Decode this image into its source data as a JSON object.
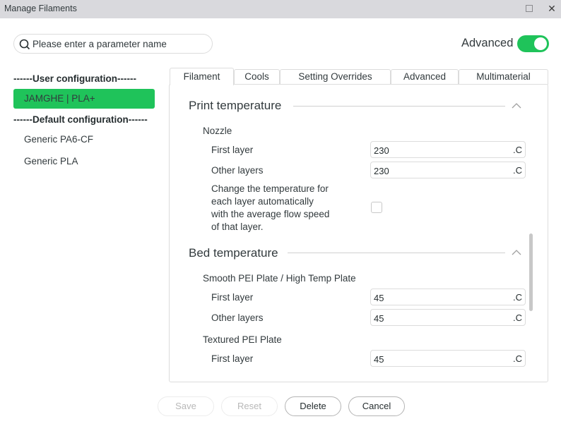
{
  "window": {
    "title": "Manage Filaments",
    "maximize_icon": "maximize-icon",
    "close_icon": "close-icon",
    "close_glyph": "✕"
  },
  "search": {
    "placeholder": "Please enter a parameter name",
    "value": "",
    "icon": "search-icon"
  },
  "advanced_toggle": {
    "label": "Advanced",
    "on": true,
    "color": "#1fc35a"
  },
  "sidebar": {
    "user_group": "------User configuration------",
    "user_items": [
      {
        "label": "JAMGHE | PLA+",
        "selected": true
      }
    ],
    "default_group": "------Default configuration------",
    "default_items": [
      {
        "label": "Generic PA6-CF",
        "selected": false
      },
      {
        "label": "Generic PLA",
        "selected": false
      }
    ]
  },
  "tabs": [
    {
      "label": "Filament",
      "active": true
    },
    {
      "label": "Cools",
      "active": false
    },
    {
      "label": "Setting Overrides",
      "active": false
    },
    {
      "label": "Advanced",
      "active": false
    },
    {
      "label": "Multimaterial",
      "active": false
    }
  ],
  "sections": {
    "print_temperature": {
      "title": "Print temperature",
      "nozzle": {
        "label": "Nozzle",
        "first_layer": {
          "label": "First layer",
          "value": "230",
          "unit": ".C"
        },
        "other_layers": {
          "label": "Other layers",
          "value": "230",
          "unit": ".C"
        }
      },
      "auto_temp": {
        "label_lines": [
          "Change the temperature for",
          "each layer automatically",
          "with the average flow speed",
          "of that layer."
        ],
        "checked": false
      }
    },
    "bed_temperature": {
      "title": "Bed temperature",
      "smooth_pei": {
        "label": "Smooth PEI Plate / High Temp Plate",
        "first_layer": {
          "label": "First layer",
          "value": "45",
          "unit": ".C"
        },
        "other_layers": {
          "label": "Other layers",
          "value": "45",
          "unit": ".C"
        }
      },
      "textured_pei": {
        "label": "Textured PEI Plate",
        "first_layer": {
          "label": "First layer",
          "value": "45",
          "unit": ".C"
        }
      }
    }
  },
  "buttons": {
    "save": {
      "label": "Save",
      "enabled": false
    },
    "reset": {
      "label": "Reset",
      "enabled": false
    },
    "delete": {
      "label": "Delete",
      "enabled": true
    },
    "cancel": {
      "label": "Cancel",
      "enabled": true
    }
  }
}
